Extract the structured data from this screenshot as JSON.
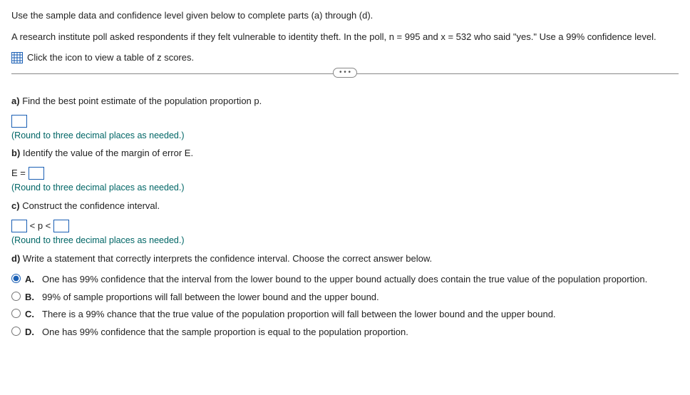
{
  "intro1": "Use the sample data and confidence level given below to complete parts (a) through (d).",
  "intro2": "A research institute poll asked respondents if they felt vulnerable to identity theft. In the poll, n = 995 and x = 532 who said \"yes.\" Use a 99% confidence level.",
  "zlink": "Click the icon to view a table of z scores.",
  "ellipsis": "• • •",
  "partA": {
    "label": "a)",
    "text": "Find the best point estimate of the population proportion p."
  },
  "hintA": "(Round to three decimal places as needed.)",
  "partB": {
    "label": "b)",
    "text": "Identify the value of the margin of error E."
  },
  "Eprefix": "E =",
  "hintB": "(Round to three decimal places as needed.)",
  "partC": {
    "label": "c)",
    "text": "Construct the confidence interval."
  },
  "ci_mid": "< p <",
  "hintC": "(Round to three decimal places as needed.)",
  "partD": {
    "label": "d)",
    "text": "Write a statement that correctly interprets the confidence interval. Choose the correct answer below."
  },
  "options": {
    "A": {
      "letter": "A.",
      "text": "One has 99% confidence that the interval from the lower bound to the upper bound actually does contain the true value of the population proportion."
    },
    "B": {
      "letter": "B.",
      "text": "99% of sample proportions will fall between the lower bound and the upper bound."
    },
    "C": {
      "letter": "C.",
      "text": "There is a 99% chance that the true value of the population proportion will fall between the lower bound and the upper bound."
    },
    "D": {
      "letter": "D.",
      "text": "One has 99% confidence that the sample proportion is equal to the population proportion."
    }
  },
  "selected": "A"
}
